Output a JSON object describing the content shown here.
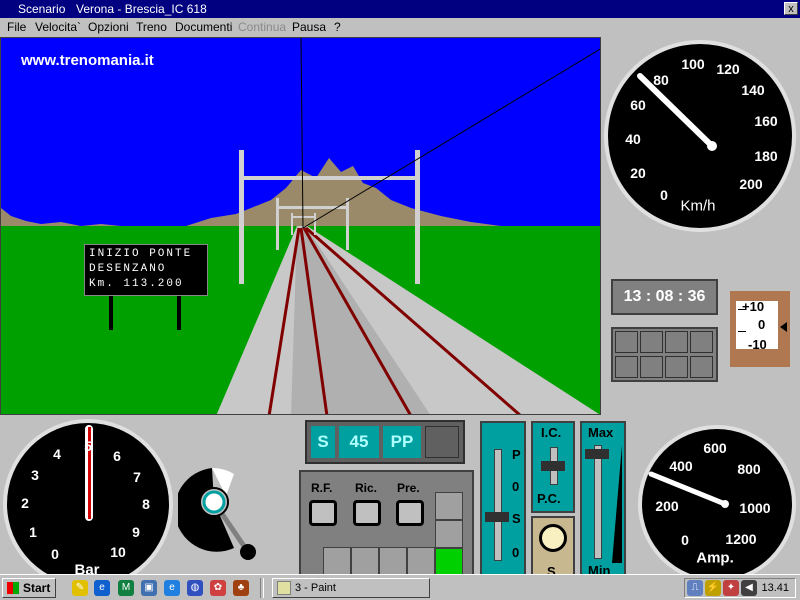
{
  "window": {
    "menu_label": "Scenario",
    "title": "Verona - Brescia_IC 618",
    "close_label": "x"
  },
  "menu": [
    "File",
    "Velocita`",
    "Opzioni",
    "Treno",
    "Documenti",
    "Continua",
    "Pausa",
    "?"
  ],
  "menu_disabled": [
    "Continua"
  ],
  "scene": {
    "watermark": "www.trenomania.it",
    "sign_lines": [
      "INIZIO PONTE",
      "DESENZANO",
      "Km. 113.200"
    ]
  },
  "speedometer": {
    "ticks": [
      "0",
      "20",
      "40",
      "60",
      "80",
      "100",
      "120",
      "140",
      "160",
      "180",
      "200"
    ],
    "unit": "Km/h"
  },
  "clock": {
    "time": "13 : 08 : 36"
  },
  "level_gauge": {
    "labels": [
      "+10",
      "0",
      "-10"
    ]
  },
  "pressure_gauge": {
    "ticks": [
      "0",
      "1",
      "2",
      "3",
      "4",
      "5",
      "6",
      "7",
      "8",
      "9",
      "10"
    ],
    "unit": "Bar"
  },
  "display": {
    "s": "S",
    "value": "45",
    "pp": "PP"
  },
  "switches": {
    "rf": "R.F.",
    "ric": "Ric.",
    "pre": "Pre."
  },
  "lever": {
    "p": "P",
    "zero1": "0",
    "s": "S",
    "zero2": "0"
  },
  "ic": {
    "top": "I.C.",
    "bottom": "P.C."
  },
  "s_button": {
    "label": "S"
  },
  "max_min": {
    "max": "Max",
    "min": "Min"
  },
  "ammeter": {
    "ticks": [
      "0",
      "200",
      "400",
      "600",
      "800",
      "1000",
      "1200"
    ],
    "unit": "Amp."
  },
  "taskbar": {
    "start": "Start",
    "task": "3 - Paint",
    "time": "13.41",
    "quick_icons": [
      "pencil-icon",
      "ie-icon",
      "mx-icon",
      "desktop-icon",
      "browser-icon",
      "globe-icon",
      "paint-icon",
      "game-icon"
    ]
  },
  "colors": {
    "sky": "#0000ff",
    "grass": "#00a000",
    "panel": "#c0c0c0",
    "titlebar": "#000080",
    "teal": "#00a0a0"
  }
}
